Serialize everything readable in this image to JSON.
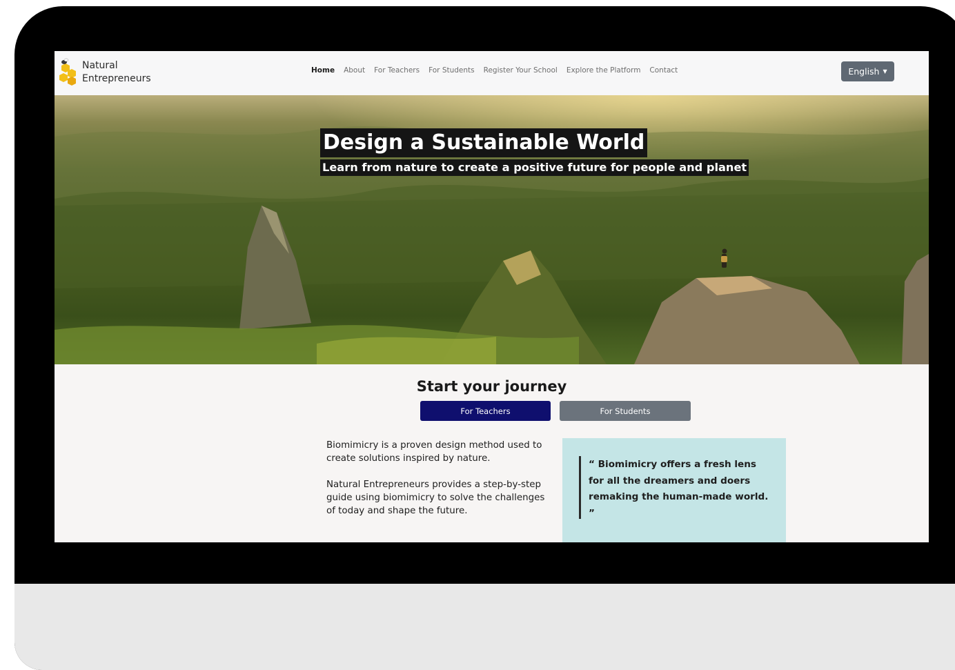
{
  "brand": {
    "line1": "Natural",
    "line2": "Entrepreneurs"
  },
  "nav": {
    "items": [
      {
        "label": "Home",
        "active": true
      },
      {
        "label": "About"
      },
      {
        "label": "For Teachers"
      },
      {
        "label": "For Students"
      },
      {
        "label": "Register Your School"
      },
      {
        "label": "Explore the Platform"
      },
      {
        "label": "Contact"
      }
    ],
    "language": "English"
  },
  "hero": {
    "title": "Design a Sustainable World",
    "subtitle": "Learn from nature to create a positive future for people and planet"
  },
  "journey": {
    "title": "Start your journey",
    "teachers_label": "For Teachers",
    "students_label": "For Students"
  },
  "intro": {
    "p1": "Biomimicry is a proven design method used to create solutions inspired by nature.",
    "p2": "Natural Entrepreneurs provides a step-by-step guide using biomimicry to solve the challenges of today and shape the future."
  },
  "quote": {
    "text": "“ Biomimicry offers a fresh lens for all the dreamers and doers remaking the human-made world. ”"
  },
  "colors": {
    "primary_button": "#0f0f6e",
    "secondary_button": "#6b737c",
    "quote_background": "#c4e5e6",
    "language_button": "#5f6873"
  }
}
